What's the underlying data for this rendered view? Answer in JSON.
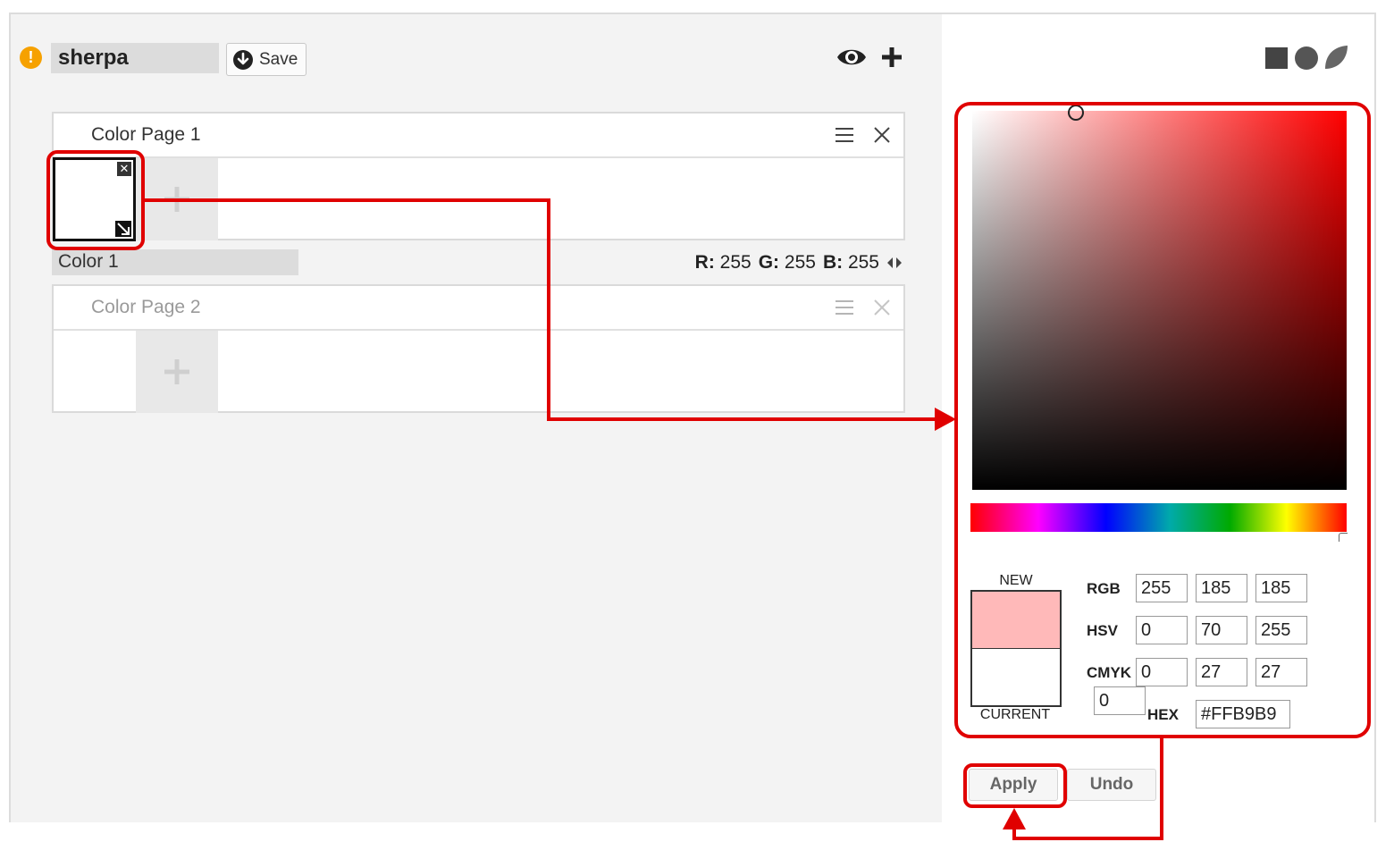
{
  "header": {
    "name_value": "sherpa",
    "save_label": "Save"
  },
  "pages": [
    {
      "title": "Color Page 1"
    },
    {
      "title": "Color Page 2"
    }
  ],
  "selected_color": {
    "name": "Color 1",
    "r_label": "R:",
    "r": "255",
    "g_label": "G:",
    "g": "255",
    "b_label": "B:",
    "b": "255"
  },
  "picker": {
    "new_label": "NEW",
    "current_label": "CURRENT",
    "new_color": "#FFB9B9",
    "current_color": "#FFFFFF",
    "hue_color": "#FF0000",
    "rgb_label": "RGB",
    "rgb": [
      "255",
      "185",
      "185"
    ],
    "hsv_label": "HSV",
    "hsv": [
      "0",
      "70",
      "255"
    ],
    "cmyk_label": "CMYK",
    "cmyk": [
      "0",
      "27",
      "27",
      "0"
    ],
    "hex_label": "HEX",
    "hex": "#FFB9B9"
  },
  "actions": {
    "apply_label": "Apply",
    "undo_label": "Undo"
  },
  "colors": {
    "warning": "#F6A100",
    "annotation": "#E00000",
    "panel_bg": "#F3F3F3"
  },
  "icons": [
    "warning-icon",
    "download-icon",
    "eye-icon",
    "plus-icon",
    "hamburger-icon",
    "close-icon",
    "square-icon",
    "circle-icon",
    "leaf-icon",
    "resize-icon",
    "arrows-icon"
  ]
}
